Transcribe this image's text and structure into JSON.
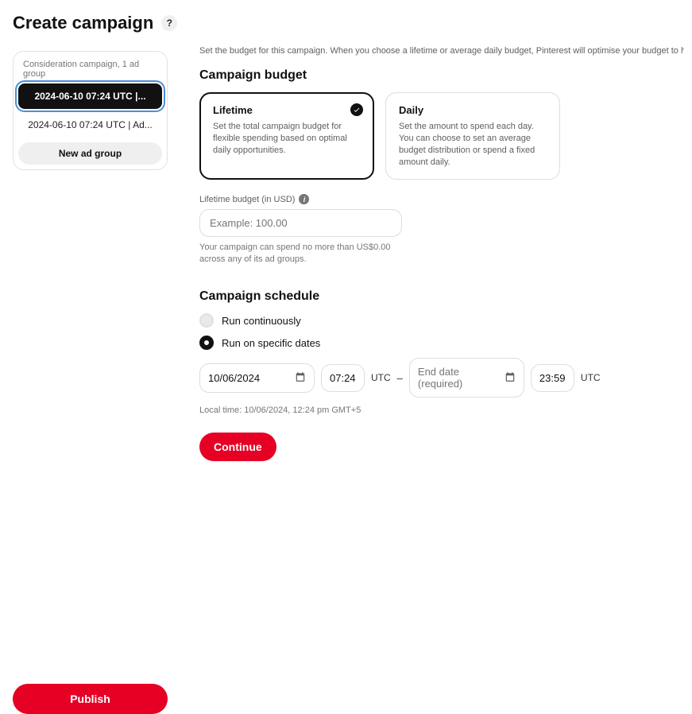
{
  "header": {
    "title": "Create campaign"
  },
  "sidebar": {
    "sub": "Consideration campaign, 1 ad group",
    "items": [
      {
        "label": "2024-06-10 07:24 UTC |..."
      },
      {
        "label": "2024-06-10 07:24 UTC | Ad..."
      }
    ],
    "new_ad_group": "New ad group",
    "publish": "Publish"
  },
  "main": {
    "intro": "Set the budget for this campaign. When you choose a lifetime or average daily budget, Pinterest will optimise your budget to help meet campaign goa",
    "budget": {
      "heading": "Campaign budget",
      "options": [
        {
          "title": "Lifetime",
          "desc": "Set the total campaign budget for flexible spending based on optimal daily opportunities."
        },
        {
          "title": "Daily",
          "desc": "Set the amount to spend each day. You can choose to set an average budget distribution or spend a fixed amount daily."
        }
      ],
      "field_label": "Lifetime budget (in USD)",
      "placeholder": "Example: 100.00",
      "helper": "Your campaign can spend no more than US$0.00 across any of its ad groups."
    },
    "schedule": {
      "heading": "Campaign schedule",
      "continuous": "Run continuously",
      "specific": "Run on specific dates",
      "start_date": "10/06/2024",
      "start_time": "07:24",
      "tz": "UTC",
      "end_placeholder": "End date (required)",
      "end_time": "23:59",
      "local": "Local time: 10/06/2024, 12:24 pm GMT+5"
    },
    "continue": "Continue"
  }
}
